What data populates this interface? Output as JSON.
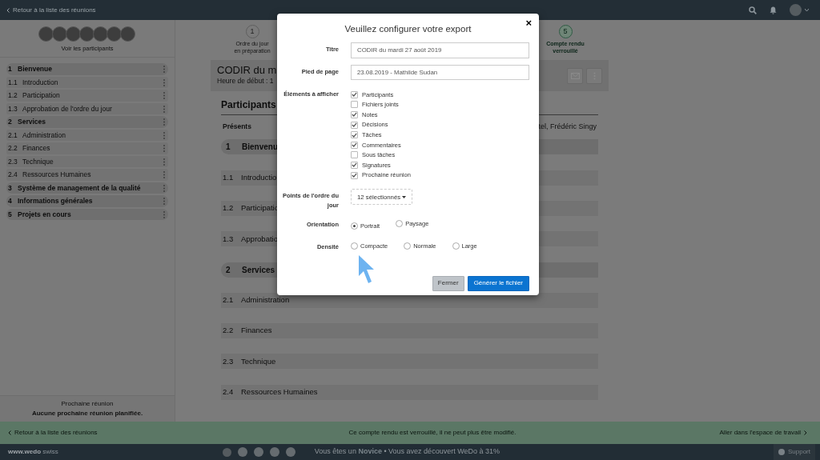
{
  "top_bar": {
    "back_link": "Retour à la liste des réunions"
  },
  "sidebar": {
    "participants_link": "Voir les participants",
    "agenda": [
      {
        "number": "1",
        "title": "Bienvenue",
        "children": [
          {
            "number": "1.1",
            "title": "Introduction"
          },
          {
            "number": "1.2",
            "title": "Participation"
          },
          {
            "number": "1.3",
            "title": "Approbation de l'ordre du jour"
          }
        ]
      },
      {
        "number": "2",
        "title": "Services",
        "children": [
          {
            "number": "2.1",
            "title": "Administration"
          },
          {
            "number": "2.2",
            "title": "Finances"
          },
          {
            "number": "2.3",
            "title": "Technique"
          },
          {
            "number": "2.4",
            "title": "Ressources Humaines"
          }
        ]
      },
      {
        "number": "3",
        "title": "Système de management de la qualité"
      },
      {
        "number": "4",
        "title": "Informations générales"
      },
      {
        "number": "5",
        "title": "Projets en cours"
      }
    ],
    "next_meeting": {
      "label": "Prochaine réunion",
      "value": "Aucune prochaine réunion planifiée."
    }
  },
  "stepper": [
    {
      "number": "1",
      "lines": [
        "Ordre du jour",
        "en préparation"
      ],
      "active": false
    },
    {
      "number": "5",
      "lines": [
        "Compte rendu",
        "verrouillé"
      ],
      "active": true
    }
  ],
  "meeting": {
    "title": "CODIR du m",
    "start": "Heure de début : 1",
    "participants_heading": "Participants",
    "present_label": "Présents",
    "present_names": "tel, Frédéric Singy",
    "agenda": [
      {
        "kind": "section",
        "number": "1",
        "title": "Bienvenu"
      },
      {
        "kind": "item",
        "number": "1.1",
        "title": "Introductio"
      },
      {
        "kind": "item",
        "number": "1.2",
        "title": "Participatio"
      },
      {
        "kind": "item",
        "number": "1.3",
        "title": "Approbatio"
      },
      {
        "kind": "section",
        "number": "2",
        "title": "Services"
      },
      {
        "kind": "item",
        "number": "2.1",
        "title": "Administration"
      },
      {
        "kind": "item",
        "number": "2.2",
        "title": "Finances"
      },
      {
        "kind": "item",
        "number": "2.3",
        "title": "Technique"
      },
      {
        "kind": "item",
        "number": "2.4",
        "title": "Ressources Humaines"
      }
    ]
  },
  "lock_bar": {
    "back": "Retour à la liste des réunions",
    "message": "Ce compte rendu est verrouillé, il ne peut plus être modifié.",
    "workspace": "Aller dans l'espace de travail"
  },
  "footer": {
    "brand": "www.wedo",
    "brand_suffix": "swiss",
    "status_prefix": "Vous êtes un",
    "rank": "Novice",
    "status_suffix": "• Vous avez découvert WeDo à 31%",
    "support": "Support"
  },
  "dialog": {
    "title": "Veuillez configurer votre export",
    "close": "×",
    "title_label": "Titre",
    "title_value": "CODIR du mardi 27 août 2019",
    "footer_label": "Pied de page",
    "footer_value": "23.08.2019 - Mathilde Sudan",
    "elements_label": "Éléments à afficher",
    "elements": [
      {
        "label": "Participants",
        "checked": true
      },
      {
        "label": "Fichiers joints",
        "checked": false
      },
      {
        "label": "Notes",
        "checked": true
      },
      {
        "label": "Décisions",
        "checked": true
      },
      {
        "label": "Tâches",
        "checked": true
      },
      {
        "label": "Commentaires",
        "checked": true
      },
      {
        "label": "Sous tâches",
        "checked": false
      },
      {
        "label": "Signatures",
        "checked": true
      },
      {
        "label": "Prochaine réunion",
        "checked": true
      }
    ],
    "points_label": "Points de l'ordre du jour",
    "points_value": "12 sélectionnés",
    "orientation_label": "Orientation",
    "orientation": [
      {
        "label": "Portrait",
        "selected": true
      },
      {
        "label": "Paysage",
        "selected": false
      }
    ],
    "density_label": "Densité",
    "density": [
      {
        "label": "Compacte",
        "selected": false
      },
      {
        "label": "Normale",
        "selected": false
      },
      {
        "label": "Large",
        "selected": false
      }
    ],
    "close_button": "Fermer",
    "generate_button": "Générer le fichier"
  }
}
